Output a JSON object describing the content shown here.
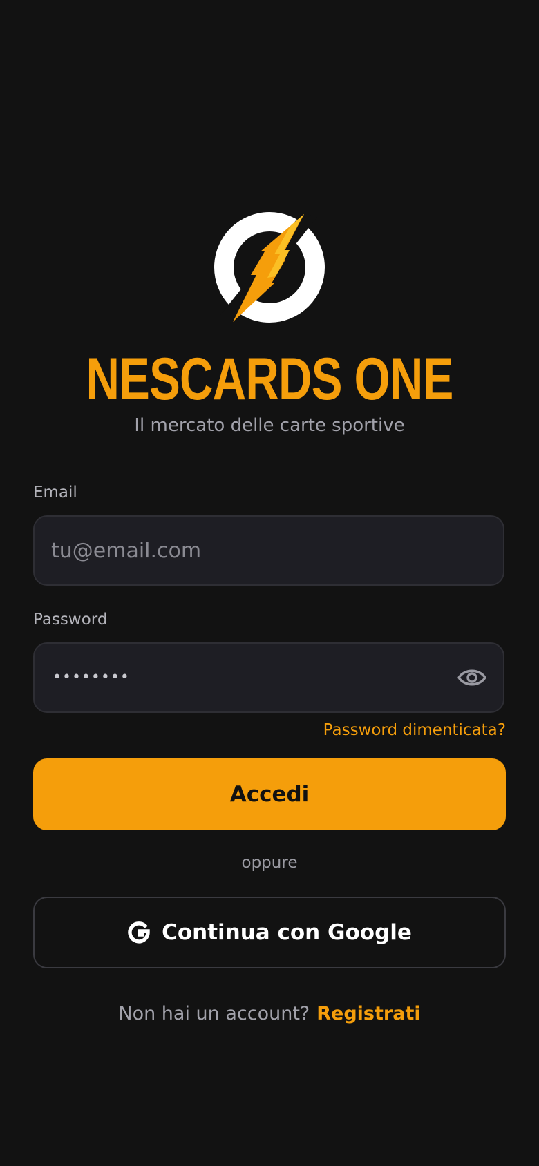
{
  "brand": {
    "title": "NESCARDS ONE",
    "subtitle": "Il mercato delle carte sportive",
    "logo_icon": "lightning-circle-logo",
    "accent_color": "#f59e0b"
  },
  "form": {
    "email": {
      "label": "Email",
      "placeholder": "tu@email.com",
      "value": ""
    },
    "password": {
      "label": "Password",
      "masked_value": "••••••••",
      "toggle_icon": "eye-icon"
    },
    "forgot_label": "Password dimenticata?",
    "submit_label": "Accedi"
  },
  "divider": {
    "label": "oppure"
  },
  "google": {
    "label": "Continua con Google",
    "icon": "google-icon"
  },
  "signup": {
    "prompt": "Non hai un account?",
    "link_label": "Registrati"
  }
}
